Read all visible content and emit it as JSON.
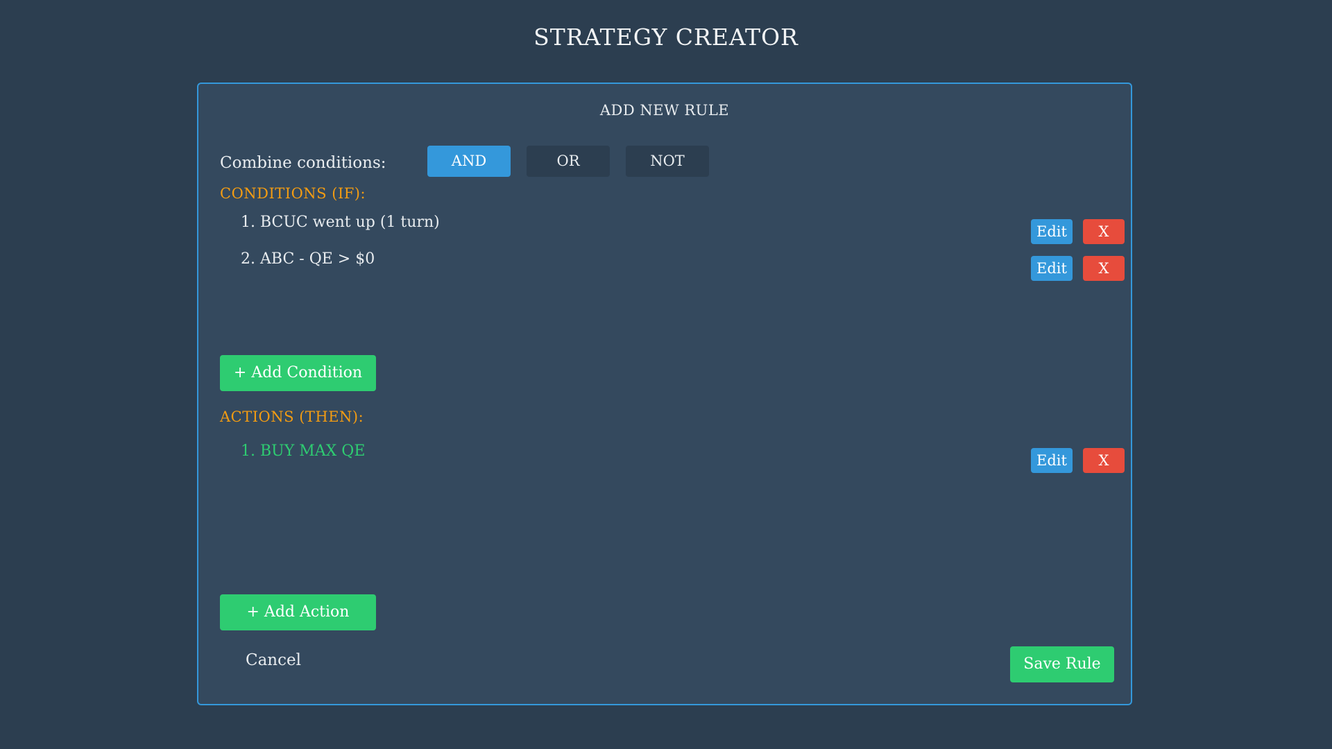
{
  "app": {
    "title": "STRATEGY CREATOR"
  },
  "panel": {
    "title": "ADD NEW RULE",
    "combine": {
      "label": "Combine conditions:",
      "options": [
        "AND",
        "OR",
        "NOT"
      ],
      "selected": "AND"
    },
    "conditions": {
      "label": "CONDITIONS (IF):",
      "items": [
        {
          "text": "1. BCUC went up (1 turn)",
          "edit_label": "Edit",
          "delete_label": "X"
        },
        {
          "text": "2. ABC - QE > $0",
          "edit_label": "Edit",
          "delete_label": "X"
        }
      ],
      "add_label": "+ Add Condition"
    },
    "actions": {
      "label": "ACTIONS (THEN):",
      "items": [
        {
          "text": "1. BUY MAX QE",
          "edit_label": "Edit",
          "delete_label": "X"
        }
      ],
      "add_label": "+ Add Action"
    },
    "footer": {
      "cancel_label": "Cancel",
      "save_label": "Save Rule"
    }
  },
  "colors": {
    "background": "#2c3e50",
    "panel": "#34495e",
    "accent_blue": "#3498db",
    "accent_green": "#2ecc71",
    "accent_orange": "#f39c12",
    "accent_red": "#e74c3c"
  }
}
